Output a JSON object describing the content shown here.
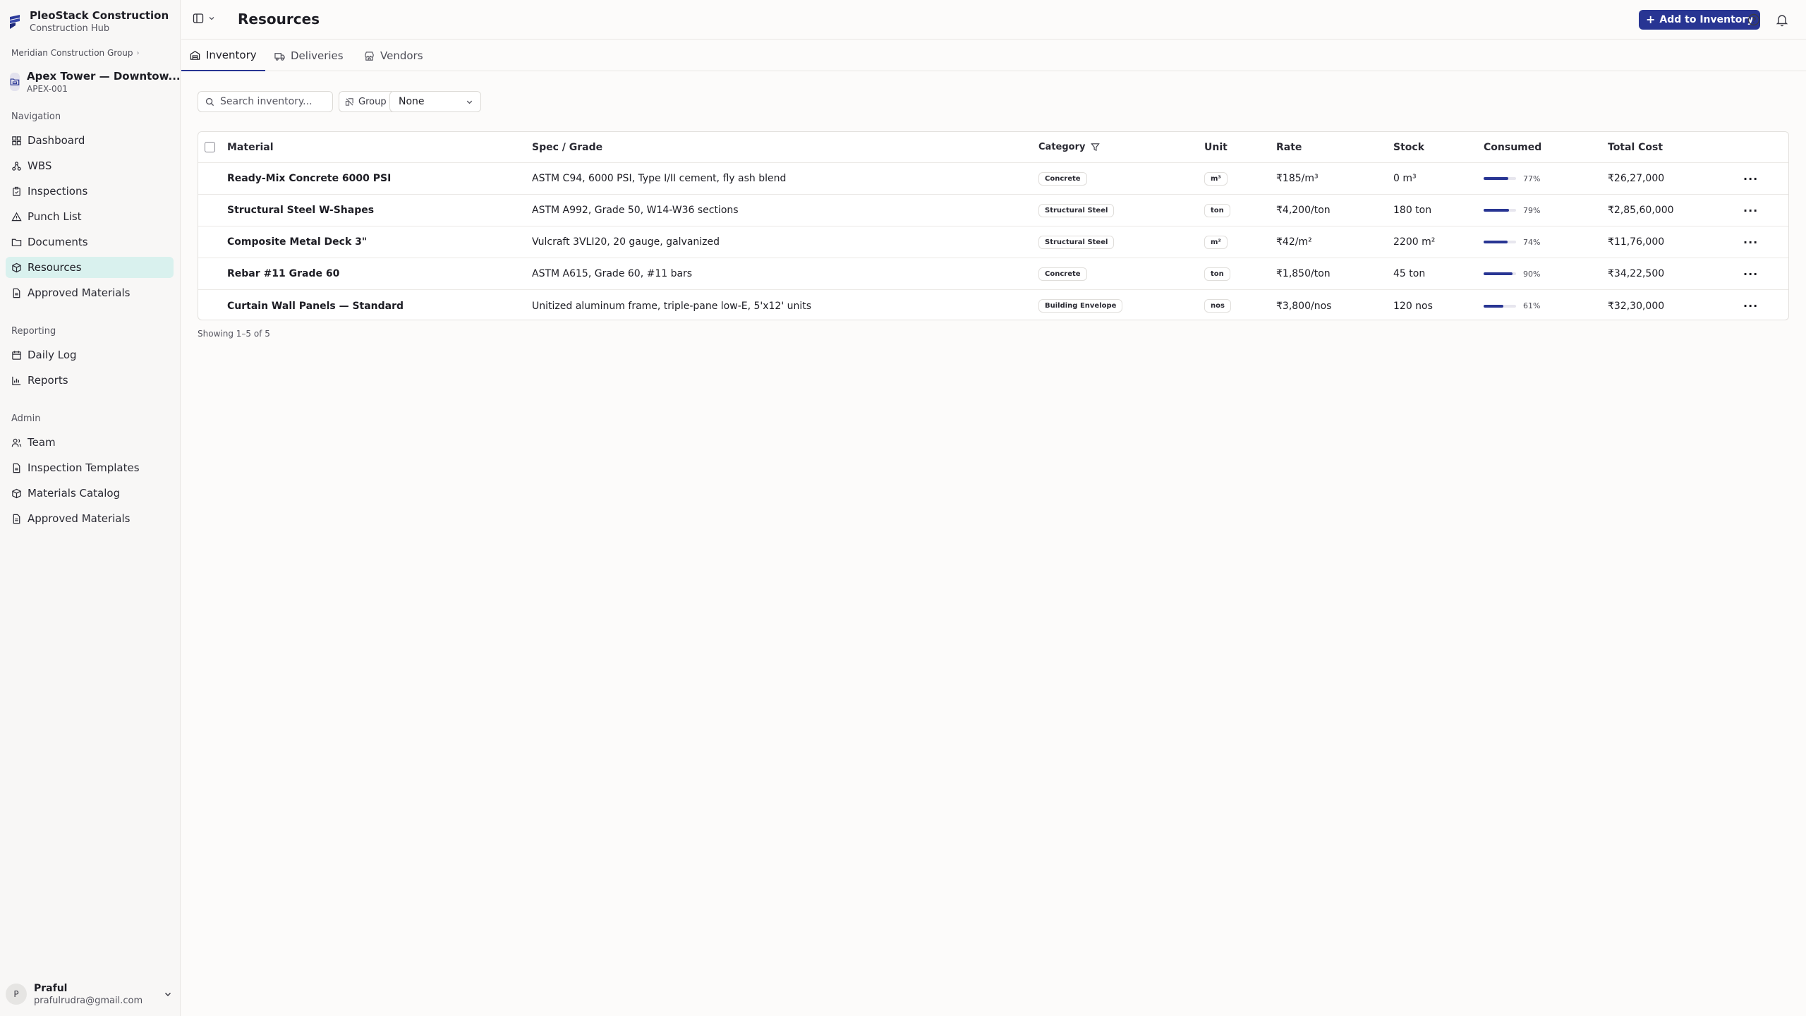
{
  "app": {
    "name": "PleoStack Construction",
    "subtitle": "Construction Hub"
  },
  "org": {
    "name": "Meridian Construction Group"
  },
  "project": {
    "name": "Apex Tower — Downtow...",
    "code": "APEX-001"
  },
  "nav": {
    "sections": {
      "navigation": "Navigation",
      "reporting": "Reporting",
      "admin": "Admin"
    },
    "items": [
      {
        "label": "Dashboard",
        "icon": "dashboard-icon"
      },
      {
        "label": "WBS",
        "icon": "wbs-icon"
      },
      {
        "label": "Inspections",
        "icon": "clipboard-icon"
      },
      {
        "label": "Punch List",
        "icon": "warning-icon"
      },
      {
        "label": "Documents",
        "icon": "folder-icon"
      },
      {
        "label": "Resources",
        "icon": "package-icon",
        "active": true
      },
      {
        "label": "Approved Materials",
        "icon": "document-icon"
      },
      {
        "label": "Daily Log",
        "icon": "calendar-icon"
      },
      {
        "label": "Reports",
        "icon": "chart-icon"
      },
      {
        "label": "Team",
        "icon": "users-icon"
      },
      {
        "label": "Inspection Templates",
        "icon": "document-icon"
      },
      {
        "label": "Materials Catalog",
        "icon": "package-icon"
      },
      {
        "label": "Approved Materials",
        "icon": "document-icon"
      }
    ]
  },
  "user": {
    "initial": "P",
    "name": "Praful",
    "email": "prafulrudra@gmail.com"
  },
  "header": {
    "title": "Resources",
    "add_button": "Add to Inventory"
  },
  "tabs": [
    {
      "label": "Inventory",
      "active": true
    },
    {
      "label": "Deliveries"
    },
    {
      "label": "Vendors"
    }
  ],
  "toolbar": {
    "search_placeholder": "Search inventory...",
    "group_label": "Group",
    "group_value": "None"
  },
  "table": {
    "columns": [
      "Material",
      "Spec / Grade",
      "Category",
      "Unit",
      "Rate",
      "Stock",
      "Consumed",
      "Total Cost"
    ],
    "rows": [
      {
        "material": "Ready-Mix Concrete 6000 PSI",
        "spec": "ASTM C94, 6000 PSI, Type I/II cement, fly ash blend",
        "category": "Concrete",
        "unit": "m³",
        "rate": "₹185/m³",
        "stock": "0 m³",
        "consumed_pct": 77,
        "consumed_label": "77%",
        "total": "₹26,27,000"
      },
      {
        "material": "Structural Steel W-Shapes",
        "spec": "ASTM A992, Grade 50, W14-W36 sections",
        "category": "Structural Steel",
        "unit": "ton",
        "rate": "₹4,200/ton",
        "stock": "180 ton",
        "consumed_pct": 79,
        "consumed_label": "79%",
        "total": "₹2,85,60,000"
      },
      {
        "material": "Composite Metal Deck 3\"",
        "spec": "Vulcraft 3VLI20, 20 gauge, galvanized",
        "category": "Structural Steel",
        "unit": "m²",
        "rate": "₹42/m²",
        "stock": "2200 m²",
        "consumed_pct": 74,
        "consumed_label": "74%",
        "total": "₹11,76,000"
      },
      {
        "material": "Rebar #11 Grade 60",
        "spec": "ASTM A615, Grade 60, #11 bars",
        "category": "Concrete",
        "unit": "ton",
        "rate": "₹1,850/ton",
        "stock": "45 ton",
        "consumed_pct": 90,
        "consumed_label": "90%",
        "total": "₹34,22,500"
      },
      {
        "material": "Curtain Wall Panels — Standard",
        "spec": "Unitized aluminum frame, triple-pane low-E, 5'x12' units",
        "category": "Building Envelope",
        "unit": "nos",
        "rate": "₹3,800/nos",
        "stock": "120 nos",
        "consumed_pct": 61,
        "consumed_label": "61%",
        "total": "₹32,30,000"
      }
    ],
    "footer": "Showing 1–5 of 5"
  },
  "colors": {
    "accent": "#283593",
    "active_nav": "#d9f1ee"
  }
}
